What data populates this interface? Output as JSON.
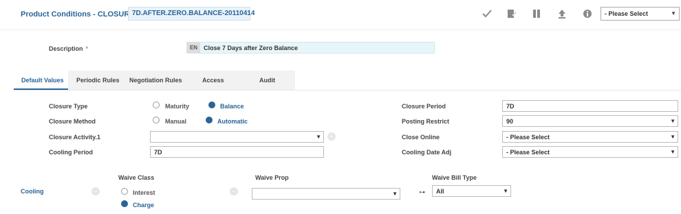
{
  "header": {
    "title": "Product Conditions - CLOSURE",
    "record_id": "7D.AFTER.ZERO.BALANCE-20110414",
    "toolbar": [
      "check-icon",
      "edit-icon",
      "pause-icon",
      "upload-icon",
      "info-icon"
    ],
    "select_value": "- Please Select"
  },
  "description": {
    "label": "Description",
    "required_mark": "*",
    "lang": "EN",
    "value": "Close 7 Days after Zero Balance"
  },
  "tabs": [
    "Default Values",
    "Periodic Rules",
    "Negotiation Rules",
    "Access",
    "Audit"
  ],
  "form": {
    "closure_type": {
      "label": "Closure Type",
      "opt1": "Maturity",
      "opt2": "Balance"
    },
    "closure_method": {
      "label": "Closure Method",
      "opt1": "Manual",
      "opt2": "Automatic"
    },
    "closure_activity": {
      "label": "Closure Activity.1",
      "value": ""
    },
    "cooling_period": {
      "label": "Cooling Period",
      "value": "7D"
    },
    "closure_period": {
      "label": "Closure Period",
      "value": "7D"
    },
    "posting_restrict": {
      "label": "Posting Restrict",
      "value": "90"
    },
    "close_online": {
      "label": "Close Online",
      "value": "- Please Select"
    },
    "cooling_date_adj": {
      "label": "Cooling Date Adj",
      "value": "- Please Select"
    }
  },
  "cooling": {
    "label": "Cooling",
    "waive_class_label": "Waive Class",
    "waive_class_opt1": "Interest",
    "waive_class_opt2": "Charge",
    "waive_prop_label": "Waive Prop",
    "waive_prop_value": "",
    "waive_bill_label": "Waive Bill Type",
    "waive_bill_value": "All"
  },
  "colors": {
    "accent": "#2a6496",
    "desc_bg": "#e8f6fa",
    "tab_bg": "#f2f2f2"
  }
}
